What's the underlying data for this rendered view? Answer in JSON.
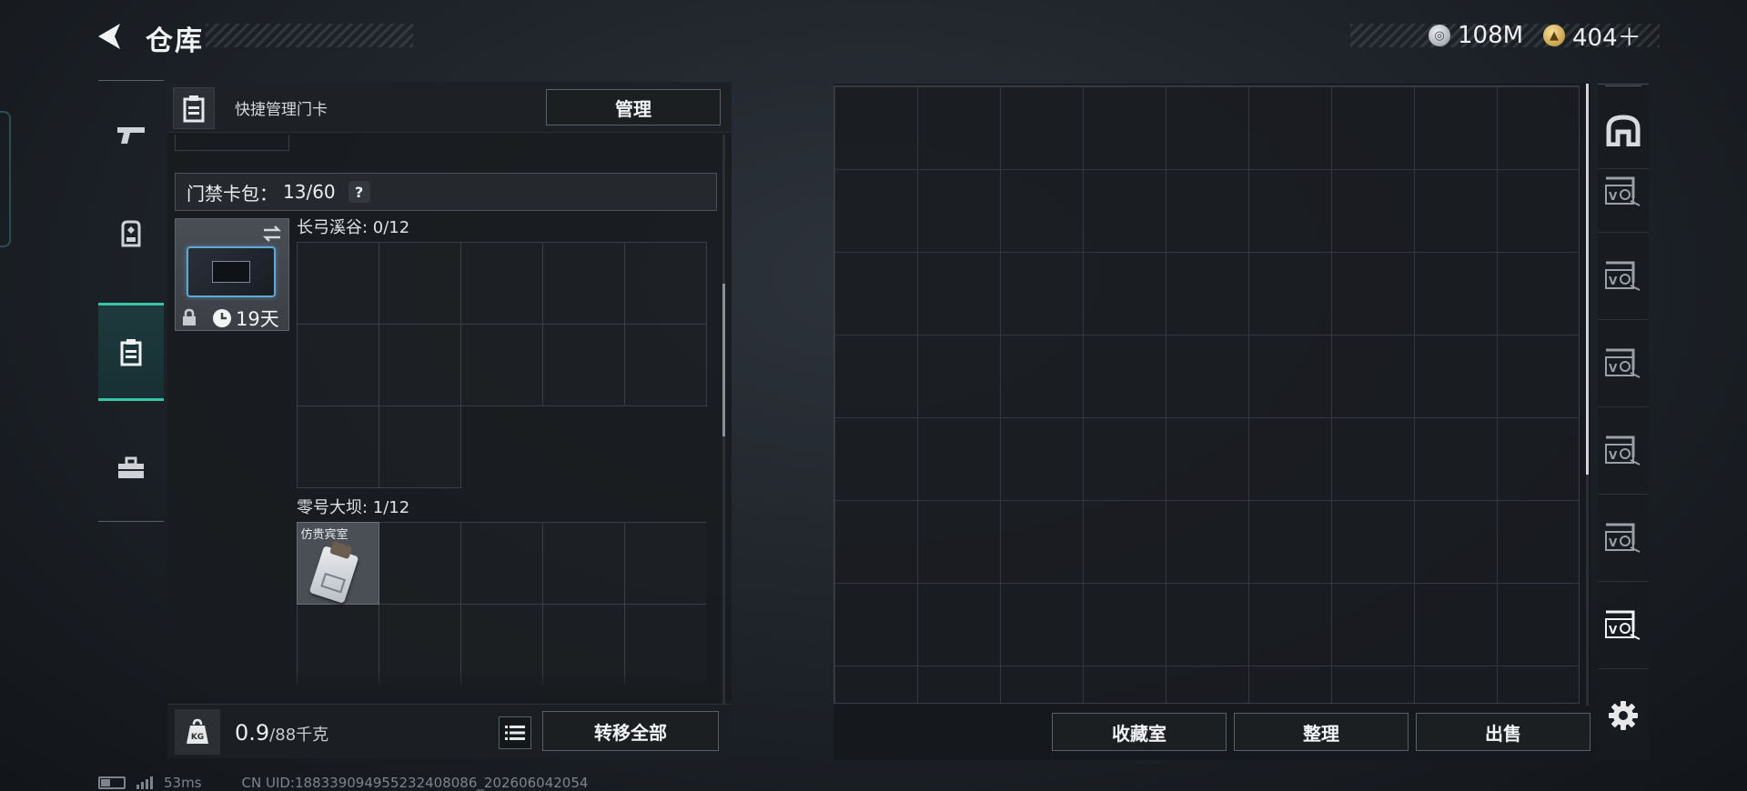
{
  "header": {
    "title": "仓库",
    "currencies": [
      {
        "icon": "silver-coin-icon",
        "value": "108M"
      },
      {
        "icon": "gold-coin-icon",
        "value": "404＋"
      }
    ]
  },
  "categories": [
    {
      "name": "weapons",
      "icon": "pistol-icon",
      "active": false
    },
    {
      "name": "armor",
      "icon": "backpack-icon",
      "active": false
    },
    {
      "name": "keycards",
      "icon": "keycard-icon",
      "active": true
    },
    {
      "name": "supplies",
      "icon": "toolbox-icon",
      "active": false
    }
  ],
  "left_panel": {
    "quick_manage_label": "快捷管理门卡",
    "manage_button": "管理",
    "card_bag": {
      "label": "门禁卡包：",
      "count": "13/60",
      "help": "?"
    },
    "keycard_item": {
      "timer": "19天"
    },
    "sections": [
      {
        "title": "长弓溪谷: 0/12"
      },
      {
        "title": "零号大坝: 1/12",
        "items": [
          {
            "label": "仿贵宾室"
          }
        ]
      }
    ],
    "footer": {
      "weight_value": "0.9",
      "weight_capacity": "/88千克",
      "transfer_all": "转移全部"
    }
  },
  "stash": {
    "buttons": {
      "collection": "收藏室",
      "organize": "整理",
      "sell": "出售"
    }
  },
  "status_bar": {
    "ping": "53ms",
    "uid": "CN UID:188339094955232408086_202606042054"
  },
  "colors": {
    "accent": "#35c6a8",
    "background": "#1d2228",
    "panel": "#181b1f",
    "cell_border": "#3a3f45"
  }
}
